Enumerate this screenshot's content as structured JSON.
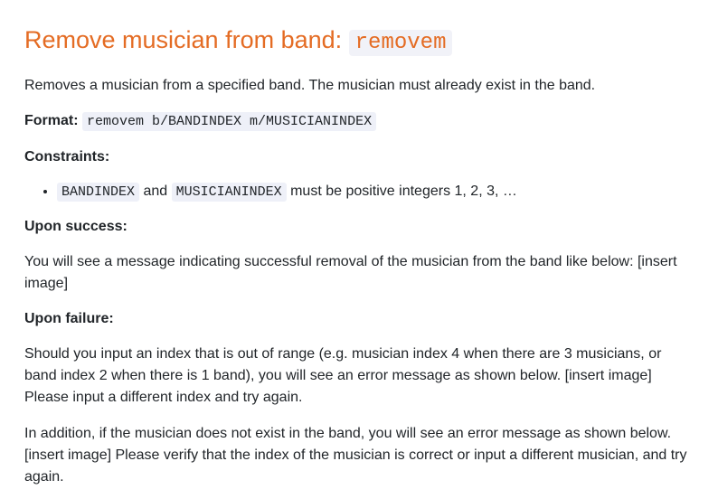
{
  "heading": {
    "text": "Remove musician from band: ",
    "code": "removem"
  },
  "description": "Removes a musician from a specified band. The musician must already exist in the band.",
  "format": {
    "label": "Format:",
    "code": "removem b/BANDINDEX m/MUSICIANINDEX"
  },
  "constraints": {
    "title": "Constraints:",
    "item": {
      "code1": "BANDINDEX",
      "and": " and ",
      "code2": "MUSICIANINDEX",
      "rest": " must be positive integers 1, 2, 3, …"
    }
  },
  "success": {
    "title": "Upon success:",
    "text": "You will see a message indicating successful removal of the musician from the band like below: [insert image]"
  },
  "failure": {
    "title": "Upon failure:",
    "text1": "Should you input an index that is out of range (e.g. musician index 4 when there are 3 musicians, or band index 2 when there is 1 band), you will see an error message as shown below. [insert image] Please input a different index and try again.",
    "text2": "In addition, if the musician does not exist in the band, you will see an error message as shown below. [insert image] Please verify that the index of the musician is correct or input a different musician, and try again."
  }
}
